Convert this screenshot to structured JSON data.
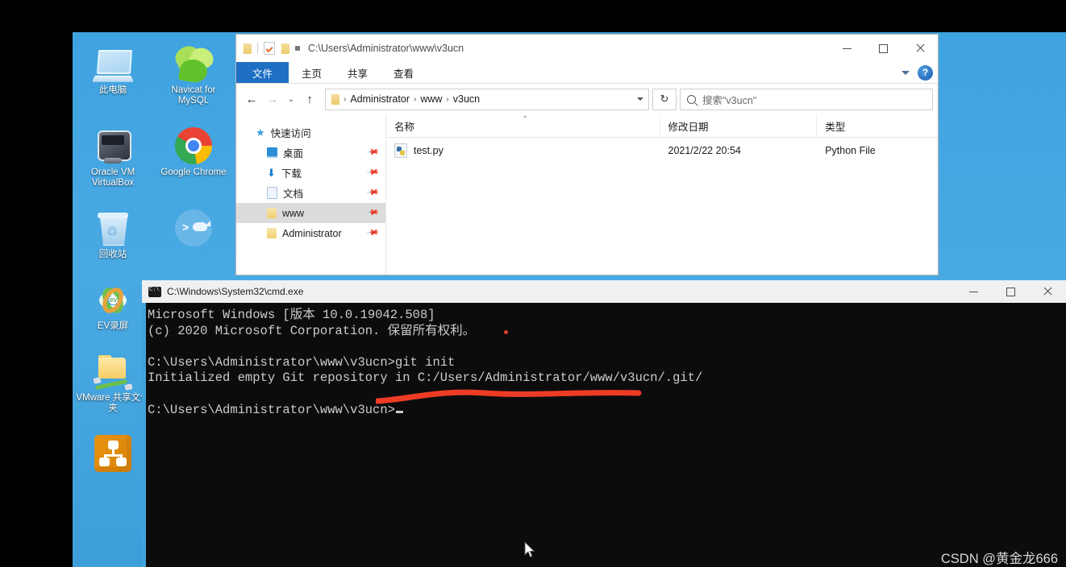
{
  "desktop": {
    "icons": [
      {
        "label": "此电脑",
        "icon": "this-pc-icon"
      },
      {
        "label": "Navicat for MySQL",
        "icon": "navicat-icon"
      },
      {
        "label": "Oracle VM VirtualBox",
        "icon": "virtualbox-icon"
      },
      {
        "label": "Google Chrome",
        "icon": "chrome-icon"
      },
      {
        "label": "回收站",
        "icon": "recycle-bin-icon"
      },
      {
        "label": "",
        "icon": "docker-icon"
      },
      {
        "label": "EV录屏",
        "icon": "ev-recorder-icon"
      },
      {
        "label": "VMware 共享文件夹",
        "icon": "vmware-shared-folder-icon"
      },
      {
        "label": "",
        "icon": "sitemap-icon"
      }
    ]
  },
  "explorer": {
    "title_path": "C:\\Users\\Administrator\\www\\v3ucn",
    "quick_access_toolbar": {
      "folder": "folder-icon",
      "properties": "properties-icon",
      "new_folder": "new-folder-icon",
      "customize": "customize-caret-icon"
    },
    "window_controls": {
      "minimize": "–",
      "maximize": "□",
      "close": "✕"
    },
    "ribbon": {
      "tabs": [
        "文件",
        "主页",
        "共享",
        "查看"
      ],
      "active_tab": "文件",
      "collapse": "chevron-down-icon",
      "help": "?"
    },
    "address": {
      "back": "←",
      "forward": "→",
      "recent": "⌄",
      "up": "↑",
      "breadcrumbs": [
        "Administrator",
        "www",
        "v3ucn"
      ],
      "separator": "›",
      "dropdown": "⌄",
      "refresh": "↻"
    },
    "search": {
      "placeholder": "搜索\"v3ucn\"",
      "icon": "search-icon"
    },
    "nav_pane": {
      "header": "快速访问",
      "items": [
        {
          "label": "桌面",
          "pinned": true,
          "selected": false
        },
        {
          "label": "下载",
          "pinned": true,
          "selected": false
        },
        {
          "label": "文档",
          "pinned": true,
          "selected": false
        },
        {
          "label": "www",
          "pinned": true,
          "selected": true
        },
        {
          "label": "Administrator",
          "pinned": true,
          "selected": false
        }
      ]
    },
    "file_list": {
      "columns": [
        "名称",
        "修改日期",
        "类型"
      ],
      "rows": [
        {
          "name": "test.py",
          "modified": "2021/2/22 20:54",
          "type": "Python File"
        }
      ]
    }
  },
  "cmd": {
    "title": "C:\\Windows\\System32\\cmd.exe",
    "window_controls": {
      "minimize": "–",
      "maximize": "□",
      "close": "✕"
    },
    "lines": [
      "Microsoft Windows [版本 10.0.19042.508]",
      "(c) 2020 Microsoft Corporation. 保留所有权利。",
      "",
      "C:\\Users\\Administrator\\www\\v3ucn>git init",
      "Initialized empty Git repository in C:/Users/Administrator/www/v3ucn/.git/",
      "",
      "C:\\Users\\Administrator\\www\\v3ucn>"
    ],
    "annotation_color": "#ee3b26"
  },
  "watermark": {
    "text": "CSDN @黄金龙666"
  }
}
